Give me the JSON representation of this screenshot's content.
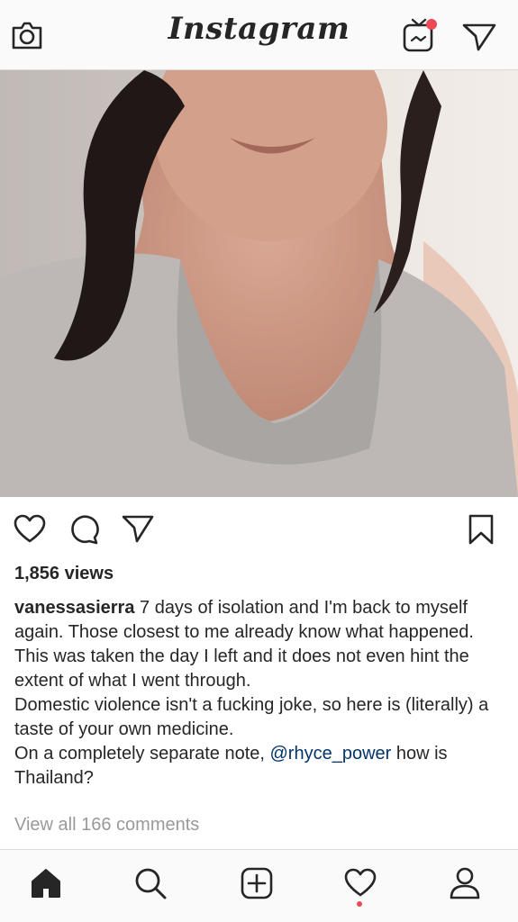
{
  "app": {
    "logo_text": "Instagram"
  },
  "header": {
    "camera_icon": "camera-icon",
    "igtv_icon": "igtv-icon",
    "direct_icon": "paper-plane-icon",
    "igtv_badge_color": "#ed4956"
  },
  "post": {
    "media_type": "video",
    "actions": {
      "like_icon": "heart-icon",
      "comment_icon": "comment-icon",
      "share_icon": "paper-plane-icon",
      "save_icon": "bookmark-icon"
    },
    "views": "1,856 views",
    "caption": {
      "username": "vanessasierra",
      "line1": " 7 days of isolation and I'm back to myself again. Those closest to me already know what happened.",
      "line2": "This was taken the day I left and it does not even hint the extent of what I went through.",
      "line3": "Domestic violence isn't a fucking joke, so here is (literally) a taste of your own medicine.",
      "line4_prefix": "On a completely separate note, ",
      "mention": "@rhyce_power",
      "line4_suffix": " how is Thailand?"
    },
    "view_all_comments": "View all 166 comments"
  },
  "tabbar": {
    "items": [
      "home-icon",
      "search-icon",
      "new-post-icon",
      "activity-icon",
      "profile-icon"
    ],
    "active": "home-icon",
    "notification_dot_color": "#ed4956"
  },
  "colors": {
    "text": "#262626",
    "muted": "#999999",
    "mention": "#003569",
    "bar_bg": "#fafafa",
    "divider": "#dbdbdb"
  }
}
